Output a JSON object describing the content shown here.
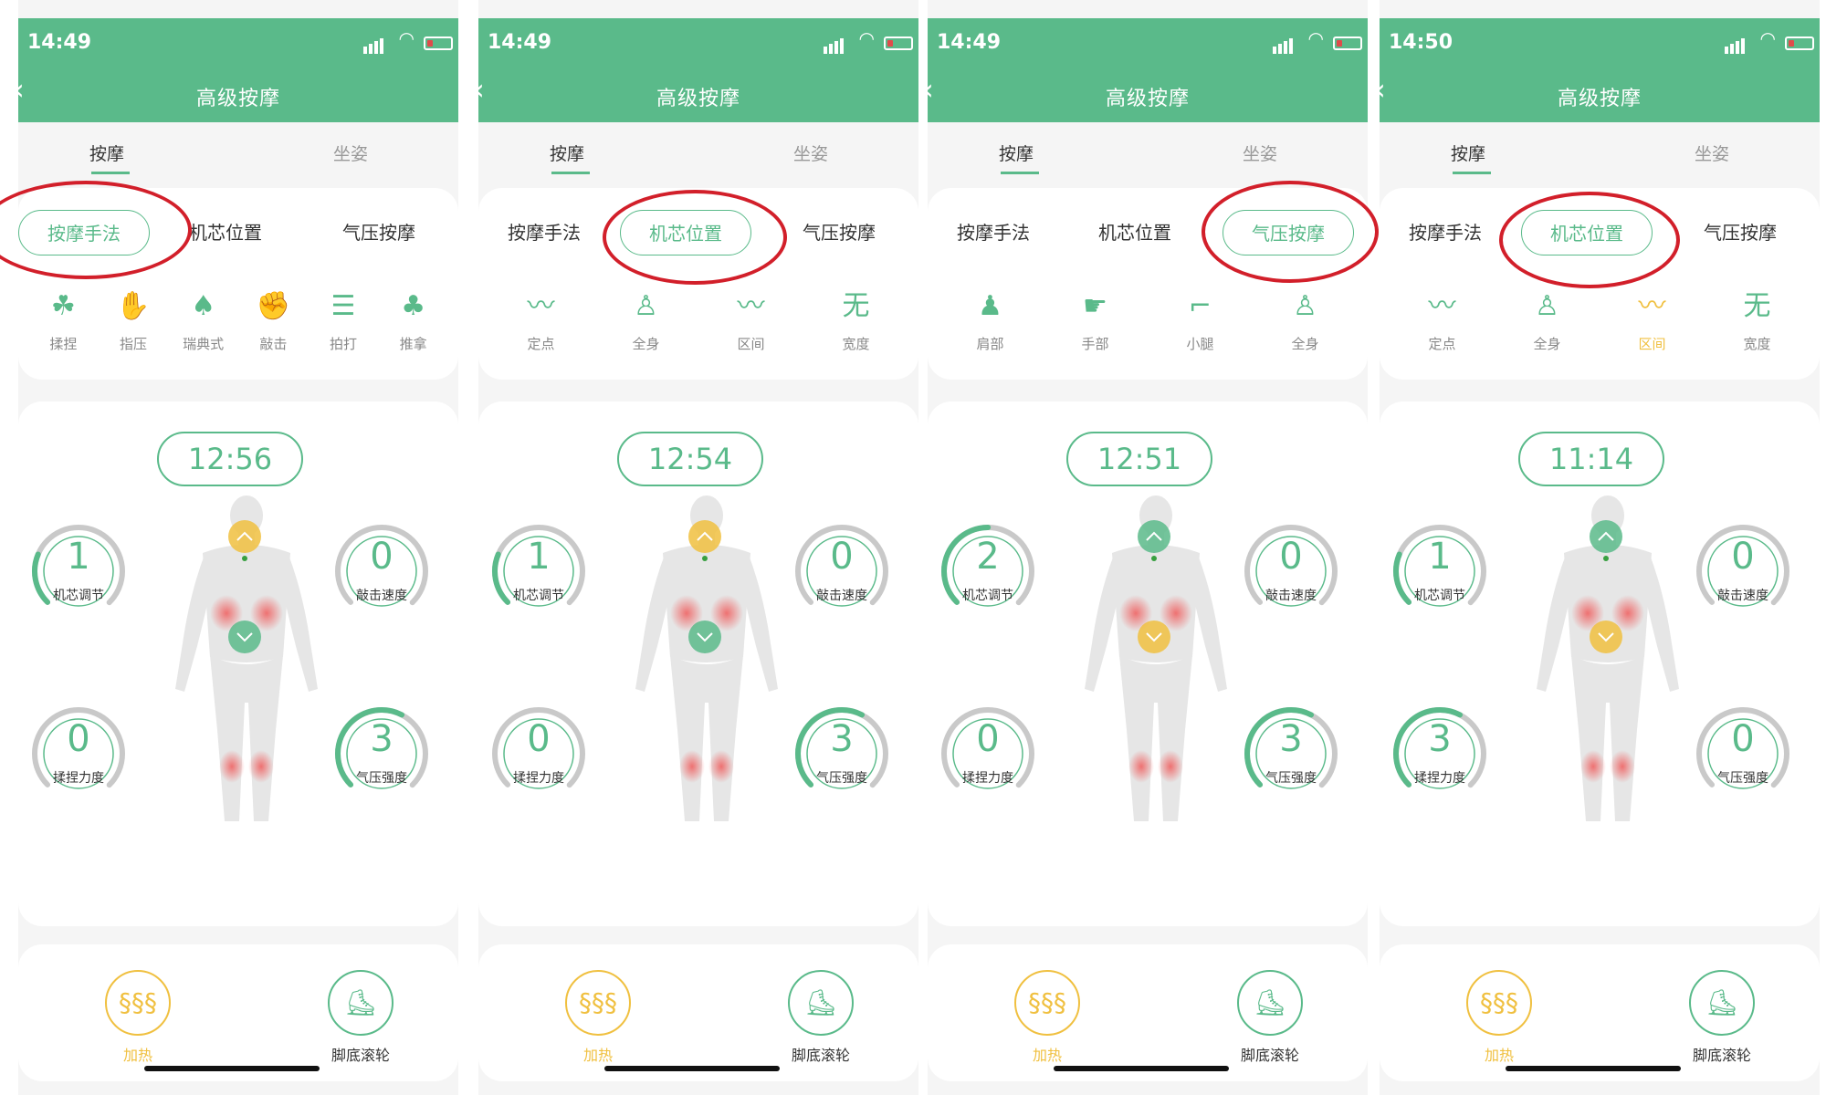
{
  "colors": {
    "brand": "#5aba8a",
    "accent": "#f0c040",
    "highlight": "#d21f2a",
    "muscle": "#ef6464"
  },
  "screens": [
    {
      "time": "14:49",
      "title": "高级按摩",
      "tabs": [
        "按摩",
        "坐姿"
      ],
      "modes": [
        "按摩手法",
        "机芯位置",
        "气压按摩"
      ],
      "active_mode": 0,
      "items": [
        {
          "label": "揉捏",
          "icon": "knead-icon"
        },
        {
          "label": "指压",
          "icon": "shiatsu-icon"
        },
        {
          "label": "瑞典式",
          "icon": "swedish-icon"
        },
        {
          "label": "敲击",
          "icon": "tap-icon"
        },
        {
          "label": "拍打",
          "icon": "pat-icon"
        },
        {
          "label": "推拿",
          "icon": "tuina-icon"
        }
      ],
      "selected_item": -1,
      "timer": "12:56",
      "top_marker": "yellow",
      "bottom_marker": "green",
      "dials": [
        {
          "value": "1",
          "label": "机芯调节",
          "level": 0.25
        },
        {
          "value": "0",
          "label": "敲击速度",
          "level": 0
        },
        {
          "value": "0",
          "label": "揉捏力度",
          "level": 0
        },
        {
          "value": "3",
          "label": "气压强度",
          "level": 0.6
        }
      ],
      "footer": [
        {
          "label": "加热",
          "icon": "heat-icon"
        },
        {
          "label": "脚底滚轮",
          "icon": "foot-roller-icon"
        }
      ]
    },
    {
      "time": "14:49",
      "title": "高级按摩",
      "tabs": [
        "按摩",
        "坐姿"
      ],
      "modes": [
        "按摩手法",
        "机芯位置",
        "气压按摩"
      ],
      "active_mode": 1,
      "items": [
        {
          "label": "定点",
          "icon": "fixed-point-icon"
        },
        {
          "label": "全身",
          "icon": "full-body-icon"
        },
        {
          "label": "区间",
          "icon": "section-icon"
        },
        {
          "label": "宽度",
          "icon": "width-icon",
          "glyph": "无"
        }
      ],
      "selected_item": -1,
      "timer": "12:54",
      "top_marker": "yellow",
      "bottom_marker": "green",
      "dials": [
        {
          "value": "1",
          "label": "机芯调节",
          "level": 0.25
        },
        {
          "value": "0",
          "label": "敲击速度",
          "level": 0
        },
        {
          "value": "0",
          "label": "揉捏力度",
          "level": 0
        },
        {
          "value": "3",
          "label": "气压强度",
          "level": 0.6
        }
      ],
      "footer": [
        {
          "label": "加热",
          "icon": "heat-icon"
        },
        {
          "label": "脚底滚轮",
          "icon": "foot-roller-icon"
        }
      ]
    },
    {
      "time": "14:49",
      "title": "高级按摩",
      "tabs": [
        "按摩",
        "坐姿"
      ],
      "modes": [
        "按摩手法",
        "机芯位置",
        "气压按摩"
      ],
      "active_mode": 2,
      "items": [
        {
          "label": "肩部",
          "icon": "shoulder-icon"
        },
        {
          "label": "手部",
          "icon": "hand-icon"
        },
        {
          "label": "小腿",
          "icon": "calf-icon"
        },
        {
          "label": "全身",
          "icon": "full-body-icon"
        }
      ],
      "selected_item": -1,
      "timer": "12:51",
      "top_marker": "green",
      "bottom_marker": "yellow",
      "dials": [
        {
          "value": "2",
          "label": "机芯调节",
          "level": 0.5
        },
        {
          "value": "0",
          "label": "敲击速度",
          "level": 0
        },
        {
          "value": "0",
          "label": "揉捏力度",
          "level": 0
        },
        {
          "value": "3",
          "label": "气压强度",
          "level": 0.6
        }
      ],
      "footer": [
        {
          "label": "加热",
          "icon": "heat-icon"
        },
        {
          "label": "脚底滚轮",
          "icon": "foot-roller-icon"
        }
      ]
    },
    {
      "time": "14:50",
      "title": "高级按摩",
      "tabs": [
        "按摩",
        "坐姿"
      ],
      "modes": [
        "按摩手法",
        "机芯位置",
        "气压按摩"
      ],
      "active_mode": 1,
      "items": [
        {
          "label": "定点",
          "icon": "fixed-point-icon"
        },
        {
          "label": "全身",
          "icon": "full-body-icon"
        },
        {
          "label": "区间",
          "icon": "section-icon"
        },
        {
          "label": "宽度",
          "icon": "width-icon",
          "glyph": "无"
        }
      ],
      "selected_item": 2,
      "timer": "11:14",
      "top_marker": "green",
      "bottom_marker": "yellow",
      "dials": [
        {
          "value": "1",
          "label": "机芯调节",
          "level": 0.25
        },
        {
          "value": "0",
          "label": "敲击速度",
          "level": 0
        },
        {
          "value": "3",
          "label": "揉捏力度",
          "level": 0.6
        },
        {
          "value": "0",
          "label": "气压强度",
          "level": 0
        }
      ],
      "footer": [
        {
          "label": "加热",
          "icon": "heat-icon"
        },
        {
          "label": "脚底滚轮",
          "icon": "foot-roller-icon"
        }
      ]
    }
  ]
}
